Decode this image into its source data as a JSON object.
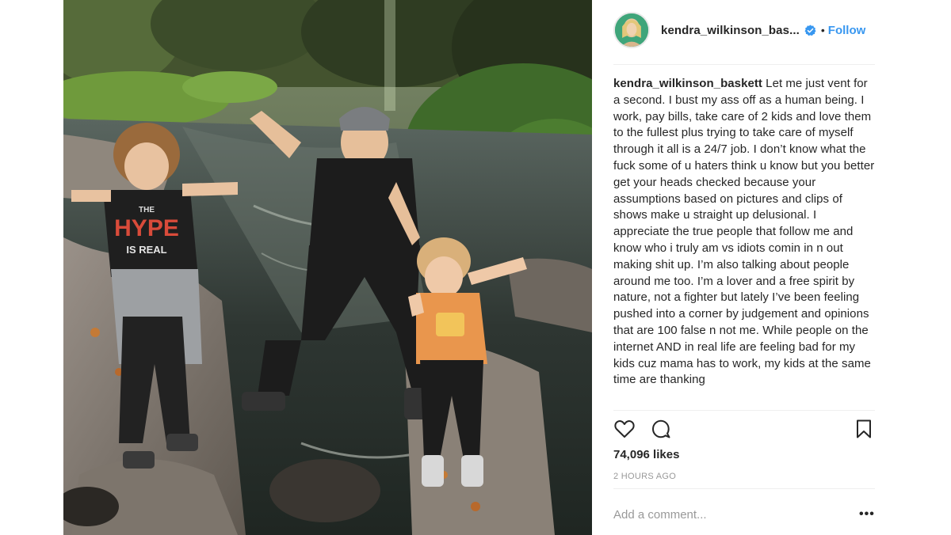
{
  "post": {
    "username": "kendra_wilkinson_bas...",
    "follow_label": "Follow",
    "separator": "•",
    "caption_user": "kendra_wilkinson_baskett",
    "caption_text": "Let me just vent for a second. I bust my ass off as a human being. I work, pay bills, take care of 2 kids and love them to the fullest plus trying to take care of myself through it all is a 24/7 job. I don’t know what the fuck some of u haters think u know but you better get your heads checked because your assumptions based on pictures and clips of shows make u straight up delusional. I appreciate the true people that follow me and know who i truly am vs idiots comin in n out making shit up. I’m also talking about people around me too. I’m a lover and a free spirit by nature, not a fighter but lately I’ve been feeling pushed into a corner by judgement and opinions that are 100 false n not me. While people on the internet AND in real life are feeling bad for my kids cuz mama has to work, my kids at the same time are thanking",
    "likes": "74,096 likes",
    "timestamp": "2 HOURS AGO",
    "comment_placeholder": "Add a comment...",
    "more_options": "•••"
  },
  "photo": {
    "shirt_text_line1": "THE",
    "shirt_text_line2": "HYPE",
    "shirt_text_line3": "IS REAL"
  },
  "icons": {
    "verified": "verified-badge-icon",
    "like": "heart-icon",
    "comment": "comment-bubble-icon",
    "save": "bookmark-icon"
  },
  "colors": {
    "accent": "#3897f0",
    "text": "#262626",
    "muted": "#999999",
    "divider": "#efefef"
  }
}
